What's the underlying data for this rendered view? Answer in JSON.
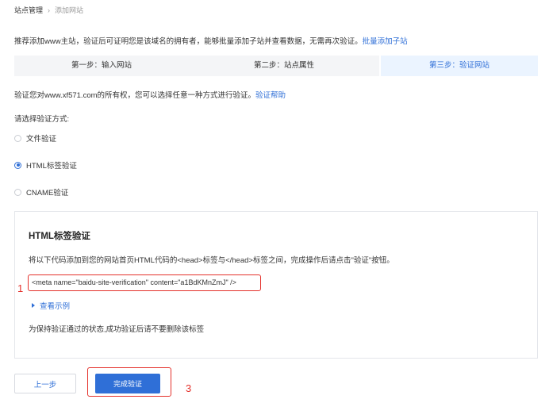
{
  "breadcrumb": {
    "root": "站点管理",
    "separator": "›",
    "current": "添加网站"
  },
  "intro": {
    "text": "推荐添加www主站，验证后可证明您是该域名的拥有者，能够批量添加子站并查看数据，无需再次验证。",
    "link": "批量添加子站"
  },
  "steps": [
    {
      "label": "第一步：输入网站",
      "active": false
    },
    {
      "label": "第二步：站点属性",
      "active": false
    },
    {
      "label": "第三步：验证网站",
      "active": true
    }
  ],
  "verify": {
    "text": "验证您对www.xf571.com的所有权，您可以选择任意一种方式进行验证。",
    "link": "验证帮助"
  },
  "choose_label": "请选择验证方式:",
  "methods": [
    {
      "label": "文件验证",
      "checked": false
    },
    {
      "label": "HTML标签验证",
      "checked": true
    },
    {
      "label": "CNAME验证",
      "checked": false
    }
  ],
  "panel": {
    "title": "HTML标签验证",
    "description": "将以下代码添加到您的网站首页HTML代码的<head>标签与</head>标签之间，完成操作后请点击\"验证\"按钮。",
    "code": "<meta name=\"baidu-site-verification\" content=\"a1BdKMnZmJ\" />",
    "example_link": "查看示例",
    "keep_note": "为保持验证通过的状态,成功验证后请不要删除该标签"
  },
  "annotations": {
    "one": "1",
    "three": "3"
  },
  "buttons": {
    "prev": "上一步",
    "finish": "完成验证"
  },
  "colors": {
    "accent": "#2f6fd7",
    "highlight": "#e4312b",
    "active_step_bg": "#ebf4ff"
  }
}
